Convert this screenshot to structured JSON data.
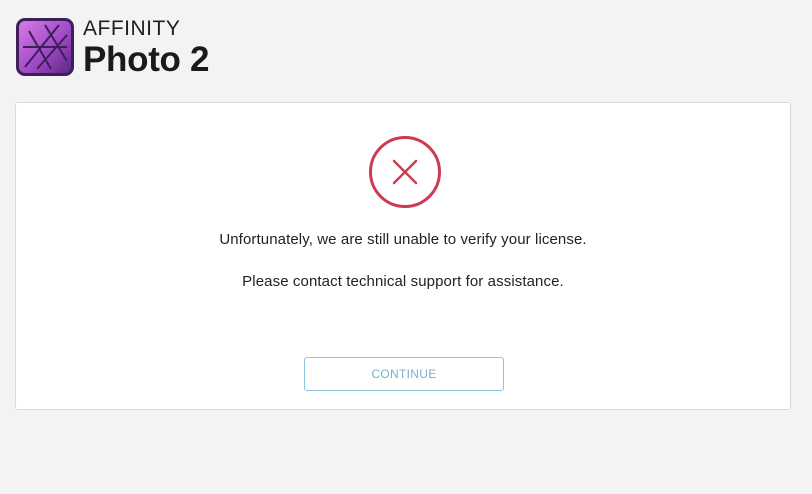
{
  "logo": {
    "brand": "AFFINITY",
    "product": "Photo 2",
    "icon": "affinity-photo-icon",
    "colors": {
      "gradient_top": "#c25ed6",
      "gradient_bottom": "#5e2a87",
      "border": "#3d1f5a"
    }
  },
  "dialog": {
    "icon": "error-x-icon",
    "icon_color": "#cc3b52",
    "message_primary": "Unfortunately, we are still unable to verify your license.",
    "message_secondary": "Please contact technical support for assistance.",
    "continue_label": "CONTINUE",
    "button_color": "#8cc3df"
  }
}
